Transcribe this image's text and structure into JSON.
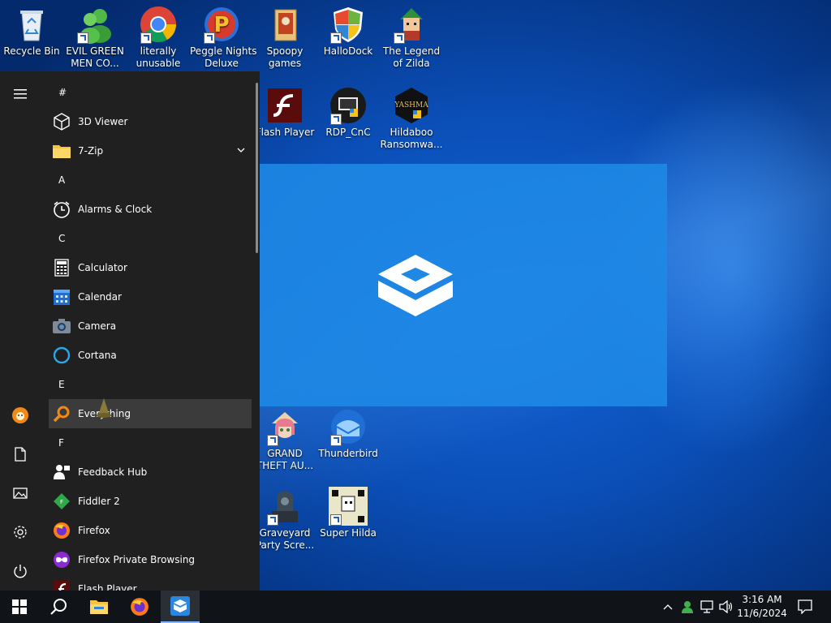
{
  "desktop": {
    "icons": [
      {
        "label": "Recycle Bin",
        "icon": "recycle-bin-icon"
      },
      {
        "label": "EVIL GREEN\nMEN CO...",
        "icon": "green-men-icon"
      },
      {
        "label": "literally\nunusable",
        "icon": "chrome-icon"
      },
      {
        "label": "Peggle Nights\nDeluxe",
        "icon": "peggle-icon"
      },
      {
        "label": "Spoopy\ngames",
        "icon": "spoopy-folder-icon"
      },
      {
        "label": "HalloDock",
        "icon": "windows-shield-icon"
      },
      {
        "label": "The Legend\nof Zilda",
        "icon": "zilda-icon"
      },
      {
        "label": "Flash Player",
        "icon": "flash-icon"
      },
      {
        "label": "RDP_CnC",
        "icon": "rdp-icon"
      },
      {
        "label": "Hildaboo\nRansomwa...",
        "icon": "yashma-icon"
      },
      {
        "label": "GRAND\nTHEFT AU...",
        "icon": "gta-icon"
      },
      {
        "label": "Thunderbird",
        "icon": "thunderbird-icon"
      },
      {
        "label": "Graveyard\nParty Scre...",
        "icon": "graveyard-icon"
      },
      {
        "label": "Super Hilda",
        "icon": "super-hilda-icon"
      }
    ]
  },
  "start_menu": {
    "rail": [
      "hamburger-menu-icon",
      "user-avatar-icon",
      "documents-icon",
      "pictures-icon",
      "settings-icon",
      "power-icon"
    ],
    "apps": [
      {
        "kind": "group",
        "label": "#"
      },
      {
        "kind": "app",
        "label": "3D Viewer",
        "icon": "3d-viewer-icon"
      },
      {
        "kind": "app",
        "label": "7-Zip",
        "icon": "folder-icon",
        "expandable": true
      },
      {
        "kind": "group",
        "label": "A"
      },
      {
        "kind": "app",
        "label": "Alarms & Clock",
        "icon": "alarm-clock-icon"
      },
      {
        "kind": "group",
        "label": "C"
      },
      {
        "kind": "app",
        "label": "Calculator",
        "icon": "calculator-icon"
      },
      {
        "kind": "app",
        "label": "Calendar",
        "icon": "calendar-icon"
      },
      {
        "kind": "app",
        "label": "Camera",
        "icon": "camera-icon"
      },
      {
        "kind": "app",
        "label": "Cortana",
        "icon": "cortana-icon"
      },
      {
        "kind": "group",
        "label": "E"
      },
      {
        "kind": "app",
        "label": "Everything",
        "icon": "everything-search-icon",
        "highlighted": true
      },
      {
        "kind": "group",
        "label": "F"
      },
      {
        "kind": "app",
        "label": "Feedback Hub",
        "icon": "feedback-hub-icon"
      },
      {
        "kind": "app",
        "label": "Fiddler 2",
        "icon": "fiddler-icon"
      },
      {
        "kind": "app",
        "label": "Firefox",
        "icon": "firefox-icon"
      },
      {
        "kind": "app",
        "label": "Firefox Private Browsing",
        "icon": "firefox-private-icon"
      },
      {
        "kind": "app",
        "label": "Flash Player",
        "icon": "flash-icon"
      }
    ]
  },
  "taskbar": {
    "pinned": [
      "windows-start-icon",
      "search-icon",
      "file-explorer-icon",
      "firefox-icon",
      "sandbox-icon"
    ],
    "tray": [
      "chevron-up-icon",
      "user-status-icon",
      "network-icon",
      "volume-icon"
    ],
    "time": "3:16 AM",
    "date": "11/6/2024",
    "notification_icon": "notification-icon"
  },
  "colors": {
    "start_menu_bg": "#202020",
    "taskbar_bg": "#101418",
    "desktop_blue": "#0b4fb8",
    "sandbox_panel": "#1e88e5"
  }
}
